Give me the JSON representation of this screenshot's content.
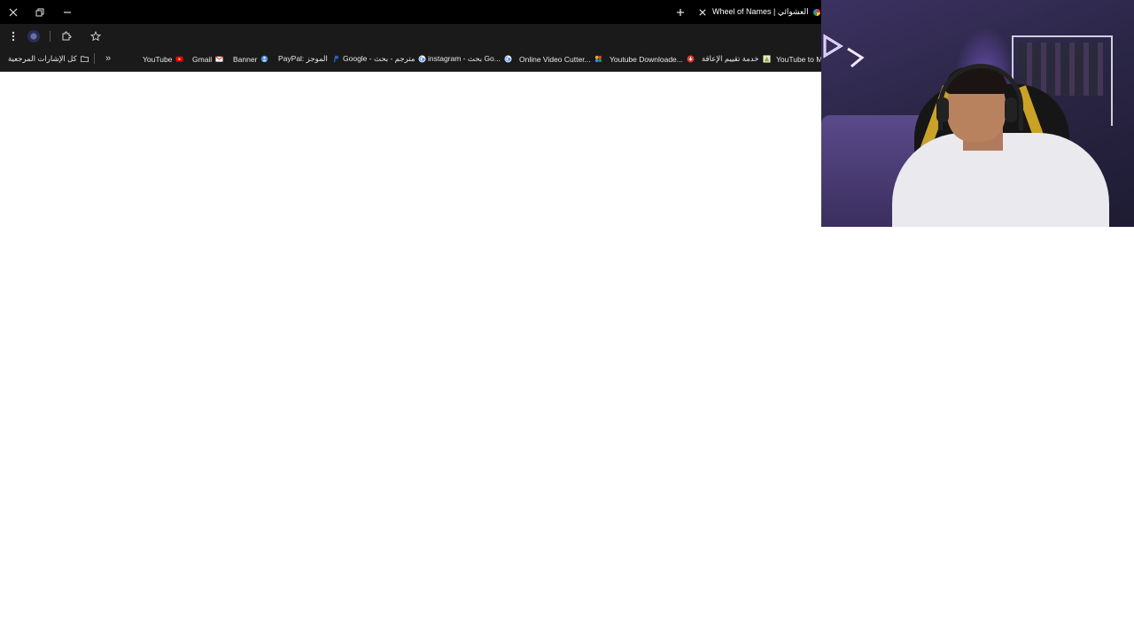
{
  "browser": {
    "tab": {
      "title": "Wheel of Names | سم العشوائي"
    },
    "bookmarks": {
      "all_bookmarks_label": "كل الإشارات المرجعية",
      "overflow_label": "»",
      "items": [
        {
          "label": "YouTube",
          "icon": "youtube-icon",
          "color": "#ff0000"
        },
        {
          "label": "Gmail",
          "icon": "gmail-icon",
          "color": "#ea4335"
        },
        {
          "label": "Banner",
          "icon": "banner-icon",
          "color": "#4a90d9"
        },
        {
          "label": "PayPal: الموجز",
          "icon": "paypal-icon",
          "color": "#1f64c2"
        },
        {
          "label": "Google - مترجم - بحث",
          "icon": "google-icon",
          "color": "#4285f4"
        },
        {
          "label": "instagram - بحث Go...",
          "icon": "google-icon",
          "color": "#4285f4"
        },
        {
          "label": "Online Video Cutter...",
          "icon": "video-cutter-icon",
          "color": "#7b61ff"
        },
        {
          "label": "Youtube Downloade...",
          "icon": "download-icon",
          "color": "#e53935"
        },
        {
          "label": "خدمة تقييم الإعاقة",
          "icon": "disability-service-icon",
          "color": "#9ccc65"
        },
        {
          "label": "YouTube to Mp",
          "icon": "mp3-icon",
          "color": "#ffffff"
        }
      ]
    }
  },
  "colors": {
    "titlebar": "#000000",
    "toolbar": "#1a1a1a",
    "content": "#ffffff"
  }
}
